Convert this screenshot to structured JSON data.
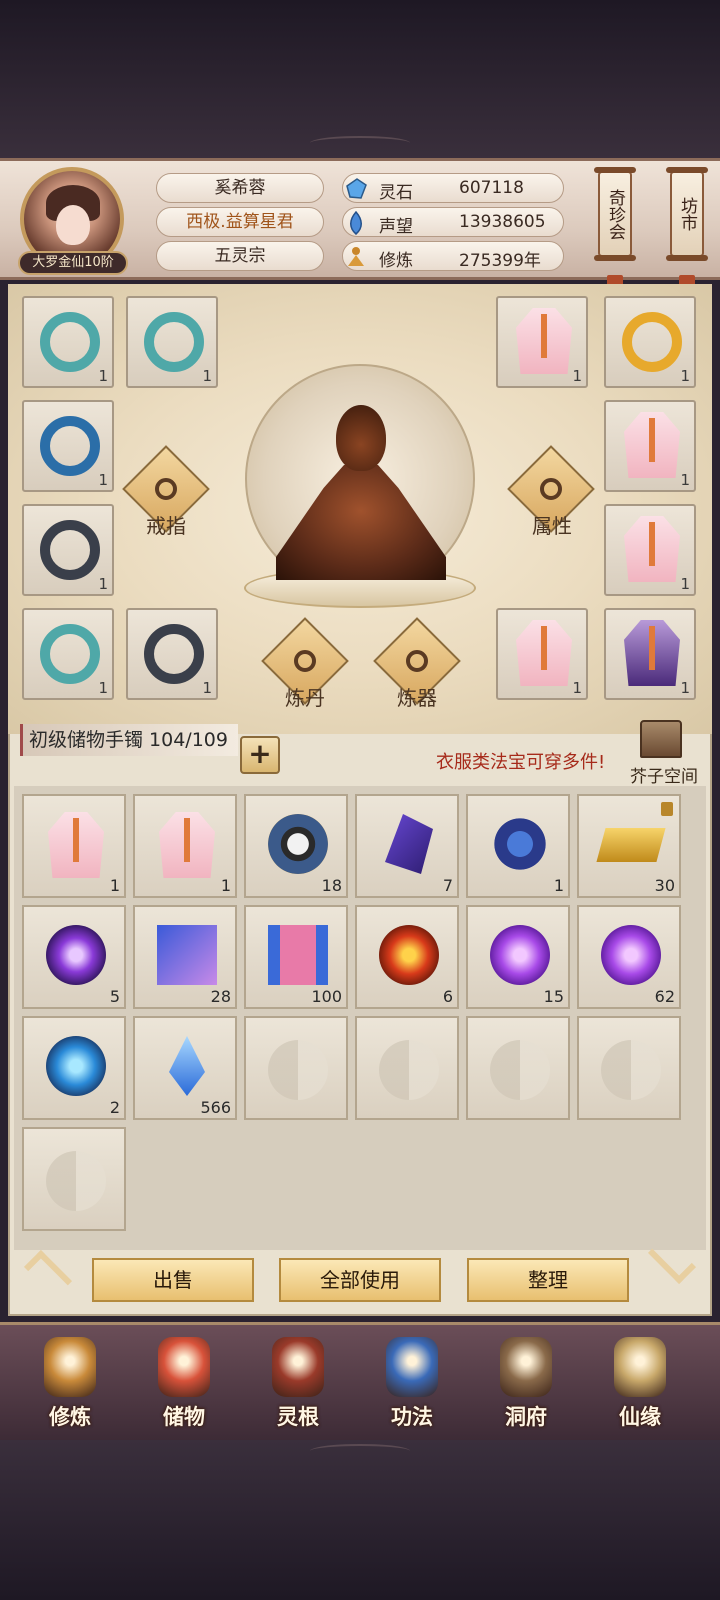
{
  "player": {
    "rank_badge": "大罗金仙10阶",
    "name": "奚希蓉",
    "title": "西极.益算星君",
    "sect": "五灵宗"
  },
  "stats": [
    {
      "icon": "spirit-stone-icon",
      "label": "灵石",
      "value": "607118"
    },
    {
      "icon": "reputation-icon",
      "label": "声望",
      "value": "13938605"
    },
    {
      "icon": "cultivation-icon",
      "label": "修炼",
      "value": "275399年"
    }
  ],
  "side_buttons": {
    "treasure_auction": "奇珍会",
    "market": "坊市"
  },
  "equipment": {
    "ring_label": "戒指",
    "attr_label": "属性",
    "alchemy_label": "炼丹",
    "forge_label": "炼器",
    "left_slots": [
      "1",
      "1",
      "1",
      "1",
      "1",
      "1"
    ],
    "right_slots": [
      "1",
      "1",
      "1",
      "1",
      "1",
      "1"
    ]
  },
  "storage": {
    "label": "初级储物手镯 104/109",
    "plus": "+",
    "notice": "衣服类法宝可穿多件!",
    "space_label": "芥子空间"
  },
  "bag_items": [
    {
      "icon": "pink-robe-icon",
      "count": "1"
    },
    {
      "icon": "pink-robe-icon",
      "count": "1"
    },
    {
      "icon": "bagua-compass-icon",
      "count": "18"
    },
    {
      "icon": "purple-crystal-icon",
      "count": "7"
    },
    {
      "icon": "spirit-herb-icon",
      "count": "1"
    },
    {
      "icon": "gold-ingot-icon",
      "count": "30"
    },
    {
      "icon": "purple-flame-orb-icon",
      "count": "5"
    },
    {
      "icon": "talisman-banner-icon",
      "count": "28"
    },
    {
      "icon": "scroll-icon",
      "count": "100"
    },
    {
      "icon": "fire-orb-icon",
      "count": "6"
    },
    {
      "icon": "violet-orb-icon",
      "count": "15"
    },
    {
      "icon": "violet-orb-icon",
      "count": "62"
    },
    {
      "icon": "blue-orb-icon",
      "count": "2"
    },
    {
      "icon": "blue-crystal-shard-icon",
      "count": "566"
    },
    {
      "icon": "empty-slot-icon",
      "count": ""
    },
    {
      "icon": "empty-slot-icon",
      "count": ""
    },
    {
      "icon": "empty-slot-icon",
      "count": ""
    },
    {
      "icon": "empty-slot-icon",
      "count": ""
    },
    {
      "icon": "empty-slot-icon",
      "count": ""
    }
  ],
  "actions": {
    "sell": "出售",
    "use_all": "全部使用",
    "sort": "整理"
  },
  "nav": [
    {
      "icon": "cultivate-icon",
      "label": "修炼"
    },
    {
      "icon": "storage-bag-icon",
      "label": "储物"
    },
    {
      "icon": "spirit-root-icon",
      "label": "灵根"
    },
    {
      "icon": "technique-book-icon",
      "label": "功法"
    },
    {
      "icon": "cave-mansion-icon",
      "label": "洞府"
    },
    {
      "icon": "immortal-fate-icon",
      "label": "仙缘"
    }
  ],
  "colors": {
    "accent_gold": "#e8c070",
    "notice_red": "#a62a1a",
    "frame": "#b4a488"
  }
}
